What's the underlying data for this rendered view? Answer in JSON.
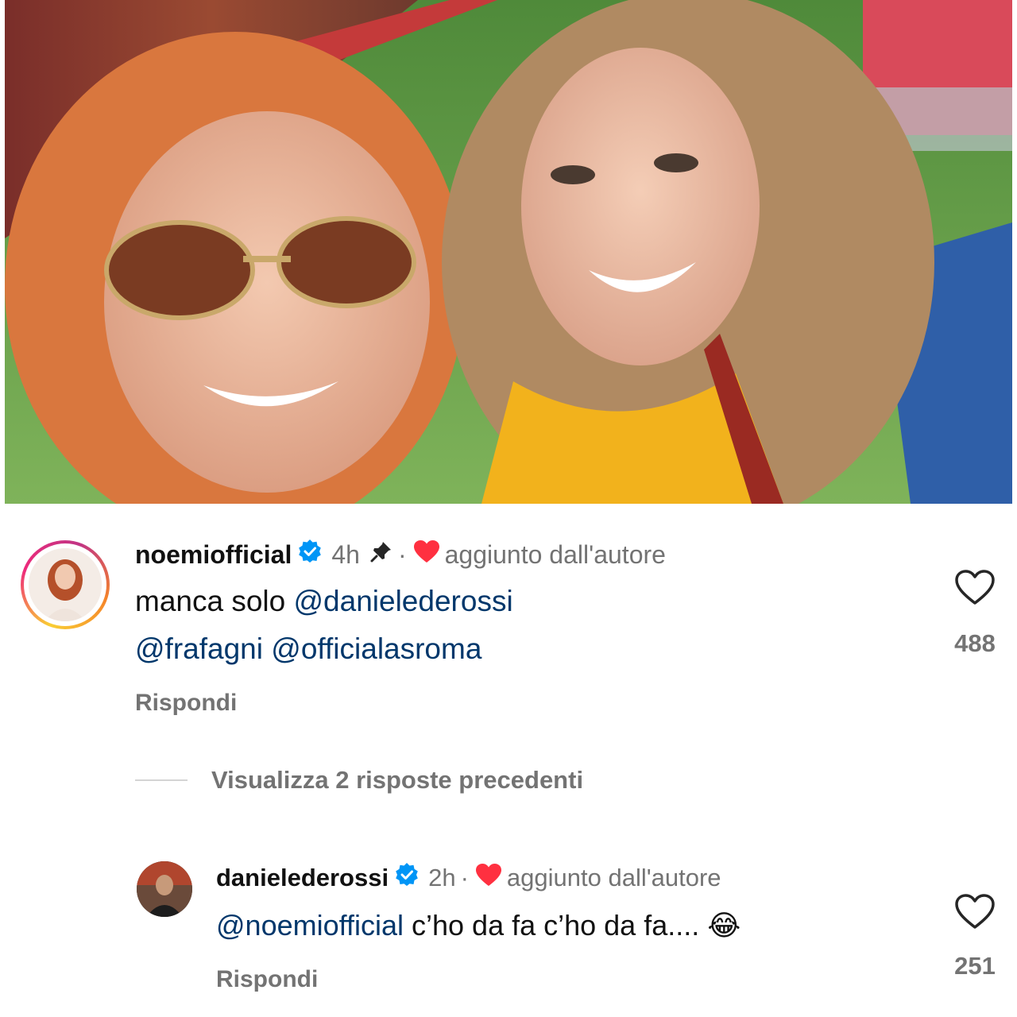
{
  "post_photo": {
    "description_icon": "selfie-photo"
  },
  "comments": [
    {
      "username": "noemiofficial",
      "verified": true,
      "time": "4h",
      "pinned": true,
      "liked_by_author_label": "aggiunto dall'autore",
      "line1_text": "manca solo ",
      "line1_mention": "@danielederossi",
      "line2_mention1": "@frafagni",
      "line2_mention2": "@officialasroma",
      "reply_label": "Rispondi",
      "like_count": "488"
    },
    {
      "username": "danielederossi",
      "verified": true,
      "time": "2h",
      "pinned": false,
      "liked_by_author_label": "aggiunto dall'autore",
      "mention": "@noemiofficial",
      "text": " c’ho da fa c’ho da fa....",
      "emoji": "😂",
      "reply_label": "Rispondi",
      "like_count": "251"
    }
  ],
  "view_replies_label": "Visualizza 2 risposte precedenti",
  "colors": {
    "verified_blue": "#0095f6",
    "heart_red": "#ff3040",
    "mention": "#00376b",
    "muted": "#737373"
  }
}
